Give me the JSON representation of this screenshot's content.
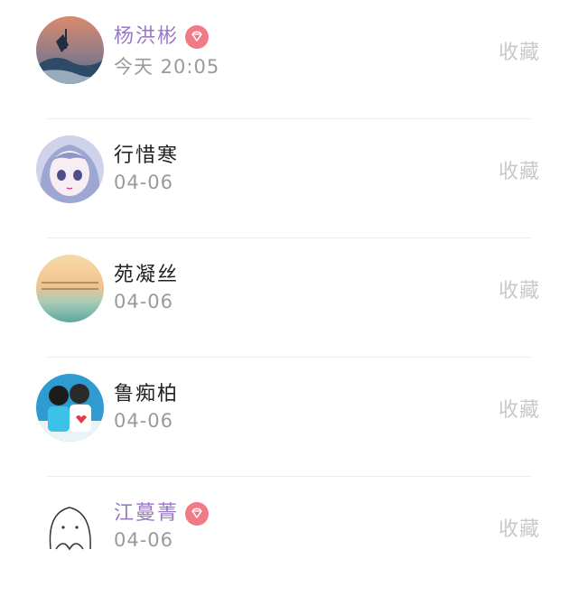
{
  "colors": {
    "vip_name": "#9a78c8",
    "normal_name": "#222222",
    "time": "#9a9a9a",
    "favorite": "#c8c8c8",
    "badge": "#f07a85"
  },
  "items": [
    {
      "name": "杨洪彬",
      "time": "今天 20:05",
      "action": "收藏",
      "vip": true,
      "avatar_icon": "landscape-avatar-icon"
    },
    {
      "name": "行惜寒",
      "time": "04-06",
      "action": "收藏",
      "vip": false,
      "avatar_icon": "anime-girl-avatar-icon"
    },
    {
      "name": "苑凝丝",
      "time": "04-06",
      "action": "收藏",
      "vip": false,
      "avatar_icon": "sunset-text-avatar-icon"
    },
    {
      "name": "鲁痴柏",
      "time": "04-06",
      "action": "收藏",
      "vip": false,
      "avatar_icon": "couple-avatar-icon"
    },
    {
      "name": "江蔓菁",
      "time": "04-06",
      "action": "收藏",
      "vip": true,
      "avatar_icon": "ghost-doodle-avatar-icon"
    }
  ]
}
